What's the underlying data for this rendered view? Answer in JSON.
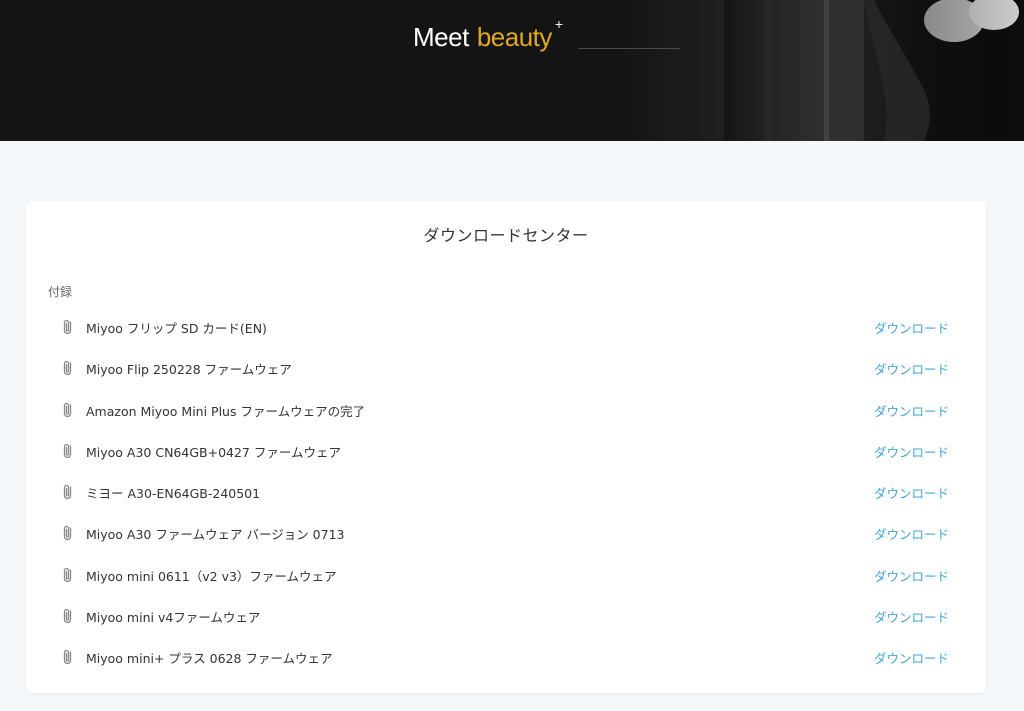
{
  "hero": {
    "title_main": "Meet",
    "title_accent": "beauty",
    "title_sup": "+"
  },
  "card": {
    "title": "ダウンロードセンター",
    "section_label": "付録",
    "files": [
      {
        "name": "Miyoo フリップ SD カード(EN)",
        "action": "ダウンロード"
      },
      {
        "name": "Miyoo Flip 250228 ファームウェア",
        "action": "ダウンロード"
      },
      {
        "name": "Amazon Miyoo Mini Plus ファームウェアの完了",
        "action": "ダウンロード"
      },
      {
        "name": "Miyoo A30 CN64GB+0427 ファームウェア",
        "action": "ダウンロード"
      },
      {
        "name": "ミヨー A30-EN64GB-240501",
        "action": "ダウンロード"
      },
      {
        "name": "Miyoo A30 ファームウェア バージョン 0713",
        "action": "ダウンロード"
      },
      {
        "name": "Miyoo mini 0611（v2 v3）ファームウェア",
        "action": "ダウンロード"
      },
      {
        "name": "Miyoo mini v4ファームウェア",
        "action": "ダウンロード"
      },
      {
        "name": "Miyoo mini+ プラス 0628 ファームウェア",
        "action": "ダウンロード"
      }
    ]
  },
  "colors": {
    "accent": "#e0a820",
    "link": "#3ea7e0",
    "background": "#f4f8fb",
    "hero_bg": "#141414"
  }
}
